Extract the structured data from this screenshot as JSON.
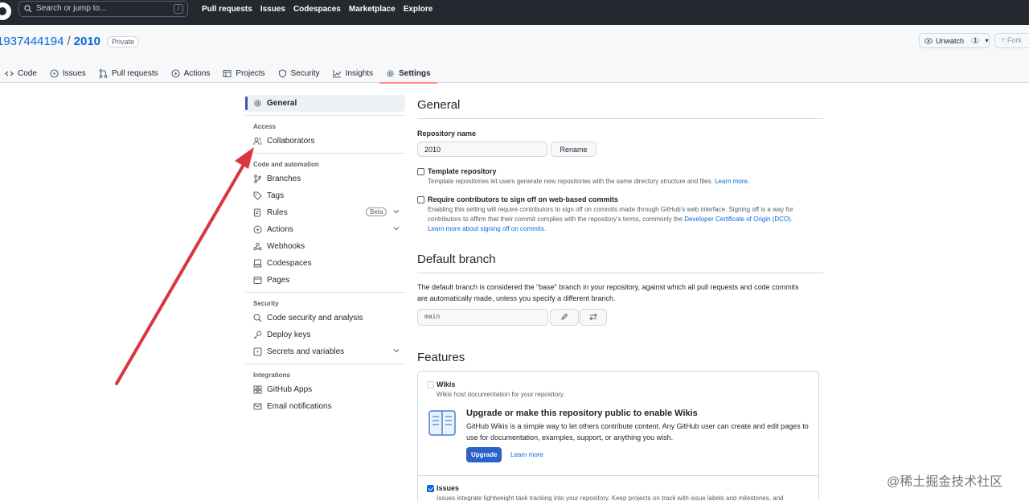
{
  "topbar": {
    "search_placeholder": "Search or jump to...",
    "search_shortcut": "/",
    "nav": [
      "Pull requests",
      "Issues",
      "Codespaces",
      "Marketplace",
      "Explore"
    ]
  },
  "repo": {
    "owner": "1937444194",
    "separator": "/",
    "name": "2010",
    "visibility": "Private",
    "watch_label": "Unwatch",
    "watch_count": "1",
    "fork_label": "Fork"
  },
  "tabs": [
    {
      "label": "Code",
      "icon": "code-icon"
    },
    {
      "label": "Issues",
      "icon": "issue-icon"
    },
    {
      "label": "Pull requests",
      "icon": "pull-request-icon"
    },
    {
      "label": "Actions",
      "icon": "play-icon"
    },
    {
      "label": "Projects",
      "icon": "table-icon"
    },
    {
      "label": "Security",
      "icon": "shield-icon"
    },
    {
      "label": "Insights",
      "icon": "graph-icon"
    },
    {
      "label": "Settings",
      "icon": "gear-icon",
      "active": true
    }
  ],
  "sidebar": {
    "general": "General",
    "access_head": "Access",
    "collaborators": "Collaborators",
    "code_head": "Code and automation",
    "branches": "Branches",
    "tags": "Tags",
    "rules": "Rules",
    "rules_badge": "Beta",
    "actions": "Actions",
    "webhooks": "Webhooks",
    "codespaces": "Codespaces",
    "pages": "Pages",
    "security_head": "Security",
    "code_security": "Code security and analysis",
    "deploy_keys": "Deploy keys",
    "secrets": "Secrets and variables",
    "integrations_head": "Integrations",
    "github_apps": "GitHub Apps",
    "email_notifications": "Email notifications"
  },
  "general": {
    "title": "General",
    "repo_name_label": "Repository name",
    "repo_name_value": "2010",
    "rename_label": "Rename",
    "template_title": "Template repository",
    "template_desc": "Template repositories let users generate new repositories with the same directory structure and files.",
    "template_link": "Learn more.",
    "signoff_title": "Require contributors to sign off on web-based commits",
    "signoff_desc": "Enabling this setting will require contributors to sign off on commits made through GitHub's web interface. Signing off is a way for contributors to affirm that their commit complies with the repository's terms, commonly the",
    "signoff_link1": "Developer Certificate of Origin (DCO).",
    "signoff_link2": "Learn more about signing off on commits."
  },
  "default_branch": {
    "title": "Default branch",
    "desc": "The default branch is considered the “base” branch in your repository, against which all pull requests and code commits are automatically made, unless you specify a different branch.",
    "value": "main"
  },
  "features": {
    "title": "Features",
    "wikis_title": "Wikis",
    "wikis_desc": "Wikis host documentation for your repository.",
    "upgrade_title": "Upgrade or make this repository public to enable Wikis",
    "upgrade_desc": "GitHub Wikis is a simple way to let others contribute content. Any GitHub user can create and edit pages to use for documentation, examples, support, or anything you wish.",
    "upgrade_button": "Upgrade",
    "learn_more": "Learn more",
    "issues_title": "Issues",
    "issues_desc": "Issues integrate lightweight task tracking into your repository. Keep projects on track with issue labels and milestones, and"
  },
  "watermark": "@稀土掘金技术社区",
  "colors": {
    "topbar": "#24292f",
    "link": "#0969da",
    "arrow": "#d9363e",
    "upgrade": "#2a62c9",
    "active_tab_underline": "#fd8c73"
  }
}
